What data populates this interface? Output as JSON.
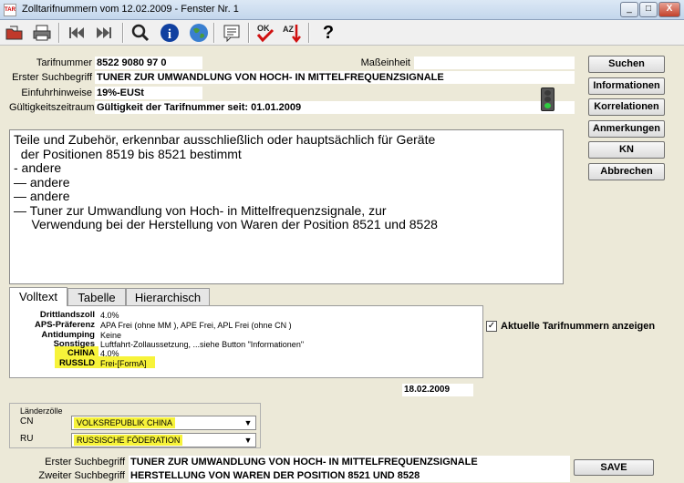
{
  "window": {
    "title": "Zolltarifnummern vom 12.02.2009 - Fenster Nr. 1",
    "controls": [
      "_",
      "□",
      "X"
    ]
  },
  "toolbar": {
    "icons": [
      "open-folder-icon",
      "printer-icon",
      "previous-icon",
      "next-icon",
      "search-icon",
      "info-icon",
      "globe-icon",
      "notes-icon",
      "ok-check-icon",
      "sort-az-icon",
      "help-icon"
    ],
    "ok_text": "OK",
    "az_text": "AZ",
    "help_text": "?"
  },
  "header": {
    "tarifnummer_label": "Tarifnummer",
    "tarifnummer_value": "8522 9080 97 0",
    "masseinheit_label": "Maßeinheit",
    "suchbegriff_label": "Erster Suchbegriff",
    "suchbegriff_value": "TUNER ZUR UMWANDLUNG VON HOCH- IN MITTELFREQUENZSIGNALE",
    "einfuhr_label": "Einfuhrhinweise",
    "einfuhr_value": "19%-EUSt",
    "gueltig_label": "Gültigkeitszeitraum",
    "gueltig_value": "Gültigkeit der Tarifnummer seit: 01.01.2009"
  },
  "buttons": {
    "suchen": "Suchen",
    "informationen": "Informationen",
    "korrelationen": "Korrelationen",
    "anmerkungen": "Anmerkungen",
    "kn": "KN",
    "abbrechen": "Abbrechen",
    "save": "SAVE"
  },
  "description": {
    "lines": [
      "Teile und Zubehör, erkennbar ausschließlich oder hauptsächlich für Geräte",
      "  der Positionen 8519 bis 8521 bestimmt",
      "- andere",
      "— andere",
      "— andere",
      "— Tuner zur Umwandlung von Hoch- in Mittelfrequenzsignale, zur",
      "     Verwendung bei der Herstellung von Waren der Position 8521 und 8528"
    ]
  },
  "tabs": [
    {
      "label": "Volltext",
      "active": true
    },
    {
      "label": "Tabelle",
      "active": false
    },
    {
      "label": "Hierarchisch",
      "active": false
    }
  ],
  "tariff_rows": [
    {
      "label": "Drittlandszoll",
      "value": "4.0%",
      "highlight": false
    },
    {
      "label": "APS-Präferenz",
      "value": "APA Frei (ohne MM ), APE Frei, APL Frei (ohne CN )",
      "highlight": false
    },
    {
      "label": "Antidumping",
      "value": "Keine",
      "highlight": false
    },
    {
      "label": "Sonstiges",
      "value": "Luftfahrt-Zollaussetzung, ...siehe Button \"Informationen\"",
      "highlight": false
    },
    {
      "label": "CHINA",
      "value": "4.0%",
      "highlight": true
    },
    {
      "label": "RUSSLD",
      "value": "Frei-[FormA]",
      "highlight": true
    }
  ],
  "date_value": "18.02.2009",
  "checkbox": {
    "label": "Aktuelle Tarifnummern anzeigen",
    "checked": true
  },
  "laenderzoelle": {
    "group_label": "Länderzölle",
    "rows": [
      {
        "code": "CN",
        "country": "VOLKSREPUBLIK CHINA"
      },
      {
        "code": "RU",
        "country": "RUSSISCHE FÖDERATION"
      }
    ]
  },
  "bottom": {
    "erster_label": "Erster Suchbegriff",
    "erster_value": "TUNER ZUR UMWANDLUNG VON HOCH- IN MITTELFREQUENZSIGNALE",
    "zweiter_label": "Zweiter Suchbegriff",
    "zweiter_value": "HERSTELLUNG VON WAREN DER POSITION 8521 UND 8528"
  },
  "colors": {
    "highlight": "#f7f33a",
    "background": "#ece9d8",
    "traffic_light_green": "#2ecc40"
  }
}
